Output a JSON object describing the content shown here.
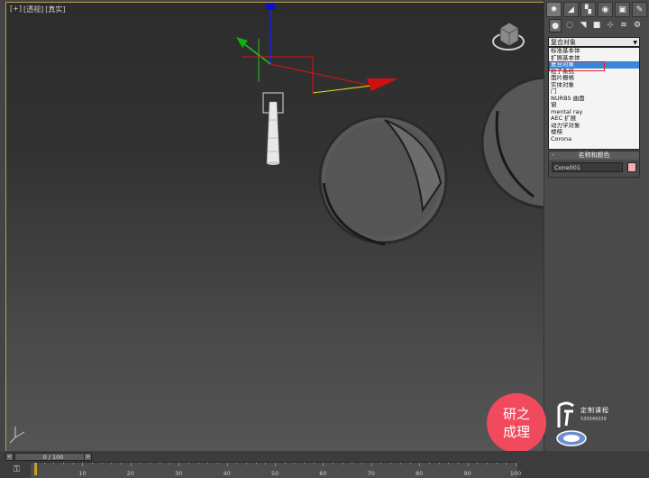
{
  "viewport": {
    "labels": [
      "[+]",
      "[透视]",
      "[真实]"
    ]
  },
  "command_panel": {
    "tabs": [
      "create-icon",
      "modify-icon",
      "hierarchy-icon",
      "motion-icon",
      "display-icon",
      "utilities-icon"
    ],
    "categories": [
      "geometry-icon",
      "shapes-icon",
      "lights-icon",
      "cameras-icon",
      "helpers-icon",
      "spacewarps-icon",
      "systems-icon"
    ],
    "dropdown_value": "复合对象",
    "dropdown_options": [
      "标准基本体",
      "扩展基本体",
      "复合对象",
      "粒子系统",
      "面片栅格",
      "实体对象",
      "门",
      "NURBS 曲面",
      "窗",
      "mental ray",
      "AEC 扩展",
      "动力学对象",
      "楼梯",
      "Corona"
    ],
    "selected_option_index": 2,
    "rollout_title": "名称和颜色",
    "rollout_toggle": "-",
    "object_name": "Cone001",
    "object_color": "#f0b0b0"
  },
  "timeline": {
    "frame_display": "0 / 100",
    "prev_label": "<",
    "next_label": ">",
    "ticks": [
      "0",
      "10",
      "20",
      "30",
      "40",
      "50",
      "60",
      "70",
      "80",
      "90",
      "100"
    ]
  },
  "watermark": {
    "badge_line1": "研之",
    "badge_line2": "成理",
    "logo_text": "定制课程",
    "logo_number": "535949339"
  },
  "colors": {
    "viewport_border": "#b8a04c",
    "selection_highlight": "#3a86d8",
    "annotation_red": "#e02020",
    "badge": "#f04a5c",
    "axis_x": "#e01010",
    "axis_y": "#20c020",
    "axis_z": "#1010e0"
  }
}
